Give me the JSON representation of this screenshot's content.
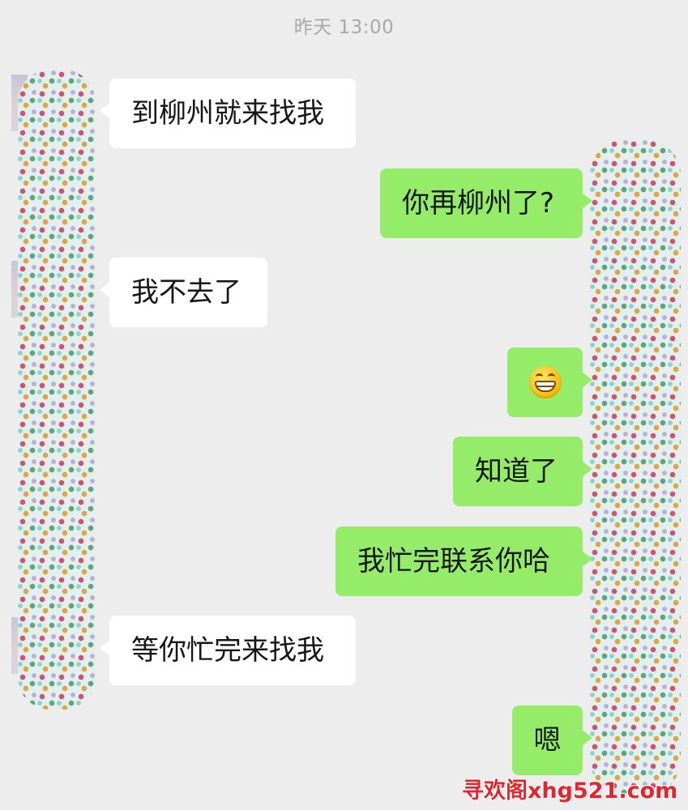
{
  "chat": {
    "timestamp": "昨天 13:00",
    "messages": [
      {
        "side": "incoming",
        "text": "到柳州就来找我"
      },
      {
        "side": "outgoing",
        "text": "你再柳州了?"
      },
      {
        "side": "incoming",
        "text": "我不去了"
      },
      {
        "side": "outgoing",
        "text": "",
        "emoji": "grinning-face-emoji"
      },
      {
        "side": "outgoing",
        "text": "知道了"
      },
      {
        "side": "outgoing",
        "text": "我忙完联系你哈"
      },
      {
        "side": "incoming",
        "text": "等你忙完来找我"
      },
      {
        "side": "outgoing",
        "text": "嗯"
      }
    ]
  },
  "watermark": {
    "text": "寻欢阁xhg521.com"
  },
  "colors": {
    "background": "#ededed",
    "incoming_bubble": "#ffffff",
    "outgoing_bubble": "#95ec69",
    "timestamp": "#a8a8a8",
    "watermark": "#e3262e"
  }
}
